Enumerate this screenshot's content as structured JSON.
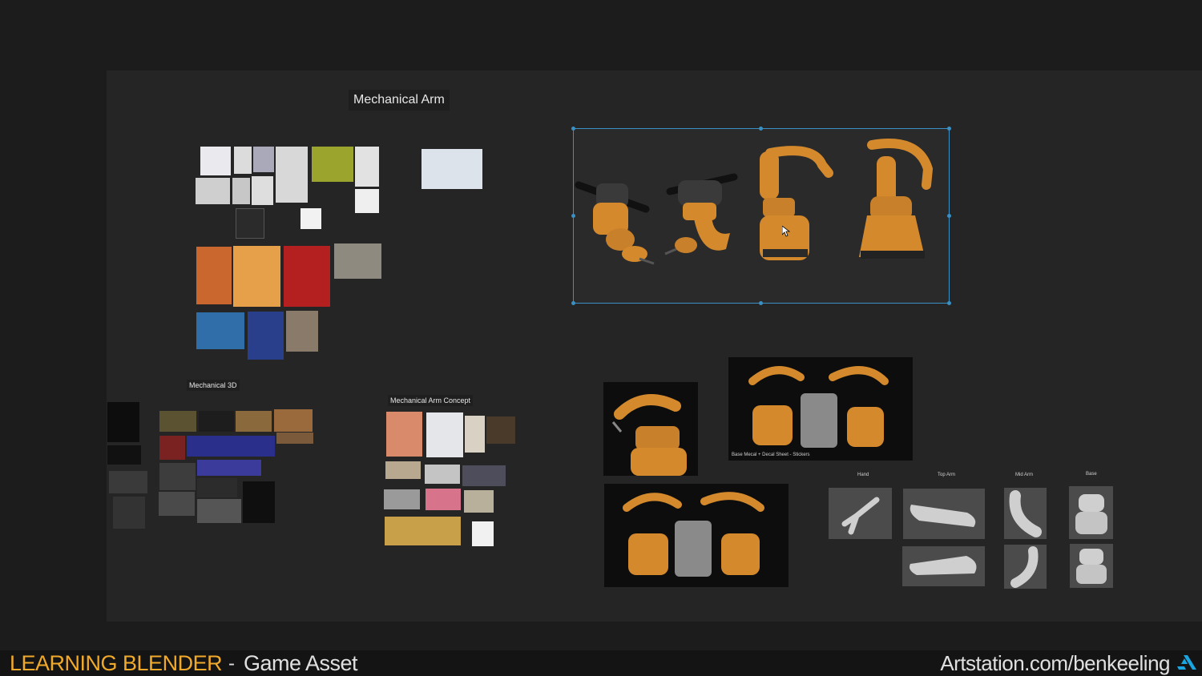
{
  "board": {
    "title": "Mechanical Arm",
    "groups": {
      "mechanical_3d": "Mechanical 3D",
      "concept": "Mechanical Arm Concept"
    },
    "render_caption": "Base Mecal + Decal Sheet - Stickers",
    "part_labels": {
      "hand": "Hand",
      "top_arm": "Top Arm",
      "mid_arm": "Mid Arm",
      "base": "Base"
    }
  },
  "footer": {
    "title": "LEARNING BLENDER",
    "separator": "-",
    "subtitle": "Game Asset",
    "site": "Artstation.com/benkeeling",
    "logo_icon": "artstation-logo-icon"
  },
  "colors": {
    "accent_orange": "#f0a92a",
    "selection_blue": "#3a8fc4",
    "robot_orange": "#d9892a"
  }
}
